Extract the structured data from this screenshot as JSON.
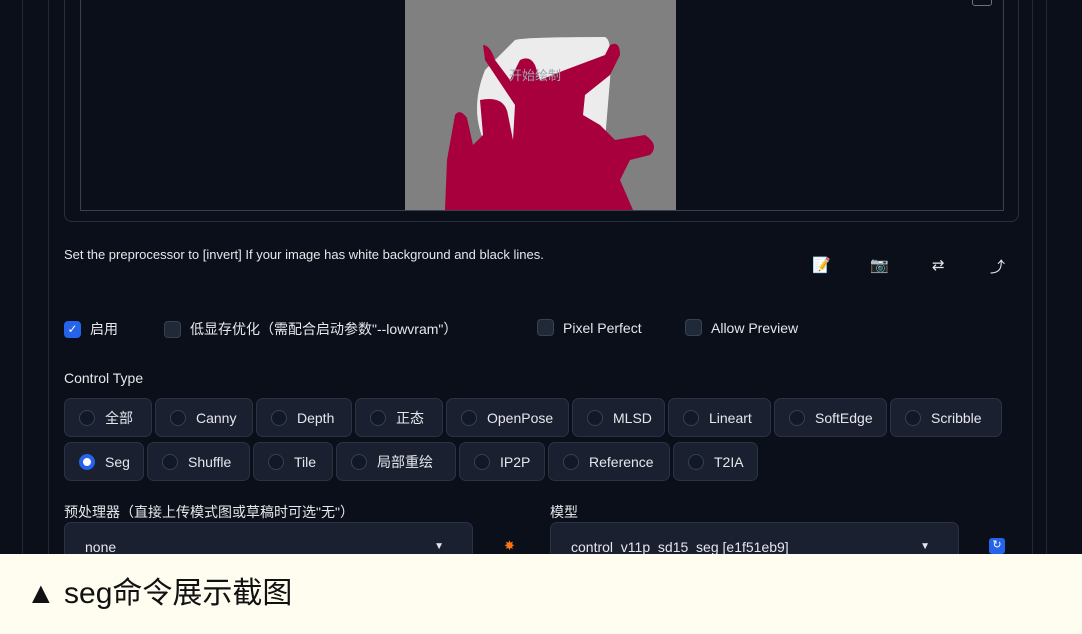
{
  "canvas": {
    "overlay_text": "开始绘制"
  },
  "hint": "Set the preprocessor to [invert] If your image has white background and black lines.",
  "tools": [
    {
      "icon": "new-canvas-icon",
      "glyph": "📝"
    },
    {
      "icon": "camera-icon",
      "glyph": "📷"
    },
    {
      "icon": "swap-icon",
      "glyph": "⇄"
    },
    {
      "icon": "send-dimensions-icon",
      "glyph": "⤴"
    }
  ],
  "checkboxes": [
    {
      "label": "启用",
      "checked": true
    },
    {
      "label": "低显存优化（需配合启动参数\"--lowvram\"）",
      "checked": false
    },
    {
      "label": "Pixel Perfect",
      "checked": false
    },
    {
      "label": "Allow Preview",
      "checked": false
    }
  ],
  "control_type": {
    "label": "Control Type",
    "options_row1": [
      "全部",
      "Canny",
      "Depth",
      "正态",
      "OpenPose",
      "MLSD",
      "Lineart",
      "SoftEdge",
      "Scribble"
    ],
    "options_row2": [
      "Seg",
      "Shuffle",
      "Tile",
      "局部重绘",
      "IP2P",
      "Reference",
      "T2IA"
    ],
    "selected": "Seg"
  },
  "preprocessor": {
    "label": "预处理器（直接上传模式图或草稿时可选\"无\"）",
    "value": "none"
  },
  "model": {
    "label": "模型",
    "value": "control_v11p_sd15_seg [e1f51eb9]"
  },
  "caption": "▲ seg命令展示截图",
  "colors": {
    "accent": "#2563eb",
    "segment": "#a8003c",
    "background": "#0b0f19"
  }
}
